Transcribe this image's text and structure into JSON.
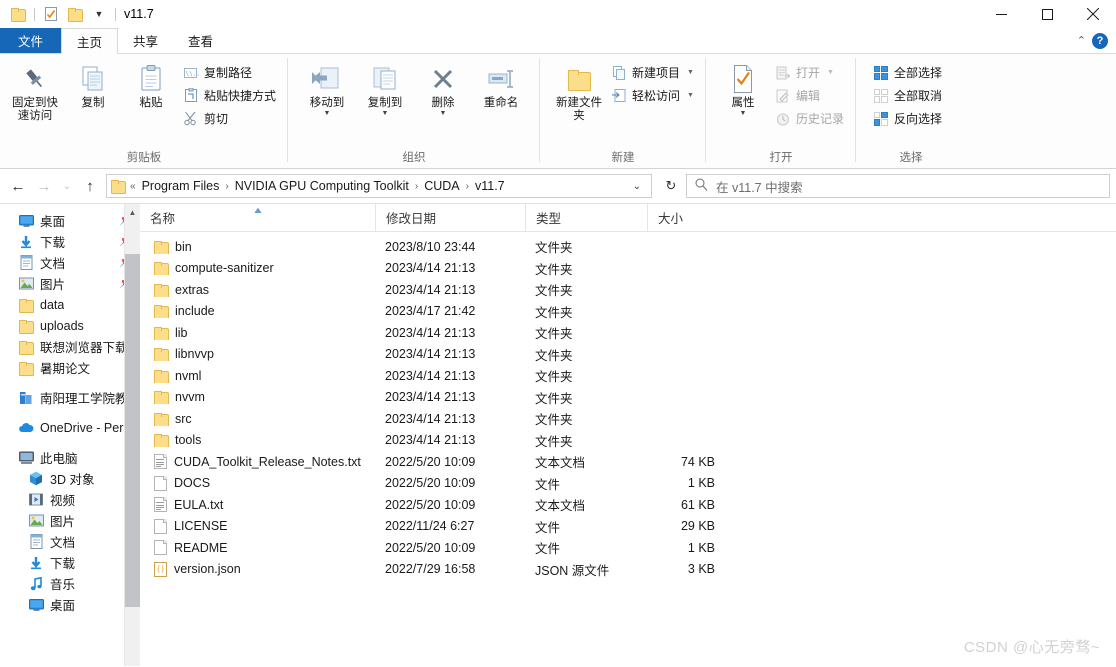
{
  "window": {
    "title": "v11.7",
    "quick_access": [
      "folder-icon",
      "properties-icon",
      "folder-icon",
      "dropdown-arrow-icon"
    ],
    "minimize_label": "–",
    "maximize_label": "☐",
    "close_label": "✕",
    "help_label": "?",
    "collapse_ribbon_label": "⌃"
  },
  "tabs": [
    {
      "label": "文件",
      "kind": "file"
    },
    {
      "label": "主页",
      "kind": "active"
    },
    {
      "label": "共享",
      "kind": "normal"
    },
    {
      "label": "查看",
      "kind": "normal"
    }
  ],
  "ribbon": {
    "groups": [
      {
        "label": "剪贴板",
        "big_buttons": [
          {
            "label": "固定到快速访问",
            "icon": "pin-icon"
          },
          {
            "label": "复制",
            "icon": "copy-icon"
          },
          {
            "label": "粘贴",
            "icon": "paste-icon"
          }
        ],
        "small_buttons": [
          {
            "label": "复制路径",
            "icon": "copy-path-icon",
            "disabled": false
          },
          {
            "label": "粘贴快捷方式",
            "icon": "paste-shortcut-icon",
            "disabled": false
          },
          {
            "label": "剪切",
            "icon": "scissors-icon",
            "disabled": false
          }
        ]
      },
      {
        "label": "组织",
        "big_buttons": [
          {
            "label": "移动到",
            "icon": "move-to-icon",
            "caret": true
          },
          {
            "label": "复制到",
            "icon": "copy-to-icon",
            "caret": true
          },
          {
            "label": "删除",
            "icon": "delete-icon",
            "caret": true
          },
          {
            "label": "重命名",
            "icon": "rename-icon"
          }
        ],
        "small_buttons": []
      },
      {
        "label": "新建",
        "big_buttons": [
          {
            "label": "新建文件夹",
            "icon": "new-folder-icon"
          }
        ],
        "small_buttons": [
          {
            "label": "新建项目",
            "icon": "new-item-icon",
            "caret": true,
            "disabled": false
          },
          {
            "label": "轻松访问",
            "icon": "easy-access-icon",
            "caret": true,
            "disabled": false
          }
        ]
      },
      {
        "label": "打开",
        "big_buttons": [
          {
            "label": "属性",
            "icon": "properties-icon",
            "caret": true
          }
        ],
        "small_buttons": [
          {
            "label": "打开",
            "icon": "open-icon",
            "caret": true,
            "disabled": true
          },
          {
            "label": "编辑",
            "icon": "edit-icon",
            "disabled": true
          },
          {
            "label": "历史记录",
            "icon": "history-icon",
            "disabled": true
          }
        ]
      },
      {
        "label": "选择",
        "big_buttons": [],
        "small_buttons": [
          {
            "label": "全部选择",
            "icon": "select-all-icon",
            "disabled": false
          },
          {
            "label": "全部取消",
            "icon": "select-none-icon",
            "disabled": false
          },
          {
            "label": "反向选择",
            "icon": "invert-selection-icon",
            "disabled": false
          }
        ]
      }
    ]
  },
  "address_bar": {
    "back_label": "←",
    "forward_label": "→",
    "recent_label": "⌄",
    "up_label": "↑",
    "overflow_label": "«",
    "crumbs": [
      "Program Files",
      "NVIDIA GPU Computing Toolkit",
      "CUDA",
      "v11.7"
    ],
    "separator": "›",
    "dropdown_label": "⌄",
    "refresh_label": "↻"
  },
  "search": {
    "placeholder": "在 v11.7 中搜索",
    "icon": "search-icon"
  },
  "sidebar": {
    "items": [
      {
        "label": "桌面",
        "icon": "desktop-icon",
        "pinned": true,
        "indent": false
      },
      {
        "label": "下载",
        "icon": "downloads-icon",
        "pinned": true,
        "indent": false
      },
      {
        "label": "文档",
        "icon": "documents-icon",
        "pinned": true,
        "indent": false
      },
      {
        "label": "图片",
        "icon": "pictures-icon",
        "pinned": true,
        "indent": false
      },
      {
        "label": "data",
        "icon": "folder-icon",
        "pinned": false,
        "indent": false
      },
      {
        "label": "uploads",
        "icon": "folder-icon",
        "pinned": false,
        "indent": false
      },
      {
        "label": "联想浏览器下载",
        "icon": "folder-icon",
        "pinned": false,
        "indent": false
      },
      {
        "label": "暑期论文",
        "icon": "folder-icon",
        "pinned": false,
        "indent": false
      },
      {
        "label": "南阳理工学院教职",
        "icon": "onedrive-business-icon",
        "pinned": false,
        "indent": false,
        "gap": true
      },
      {
        "label": "OneDrive - Pers",
        "icon": "onedrive-icon",
        "pinned": false,
        "indent": false,
        "gap": true
      },
      {
        "label": "此电脑",
        "icon": "this-pc-icon",
        "pinned": false,
        "indent": false,
        "gap": true
      },
      {
        "label": "3D 对象",
        "icon": "3d-objects-icon",
        "pinned": false,
        "indent": true
      },
      {
        "label": "视频",
        "icon": "videos-icon",
        "pinned": false,
        "indent": true
      },
      {
        "label": "图片",
        "icon": "pictures-icon",
        "pinned": false,
        "indent": true
      },
      {
        "label": "文档",
        "icon": "documents-icon",
        "pinned": false,
        "indent": true
      },
      {
        "label": "下载",
        "icon": "downloads-icon",
        "pinned": false,
        "indent": true
      },
      {
        "label": "音乐",
        "icon": "music-icon",
        "pinned": false,
        "indent": true
      },
      {
        "label": "桌面",
        "icon": "desktop-icon",
        "pinned": false,
        "indent": true
      }
    ]
  },
  "filelist": {
    "columns": [
      {
        "label": "名称",
        "sorted": true
      },
      {
        "label": "修改日期",
        "sorted": false
      },
      {
        "label": "类型",
        "sorted": false
      },
      {
        "label": "大小",
        "sorted": false
      }
    ],
    "rows": [
      {
        "name": "bin",
        "date": "2023/8/10 23:44",
        "type": "文件夹",
        "size": "",
        "icon": "folder-icon"
      },
      {
        "name": "compute-sanitizer",
        "date": "2023/4/14 21:13",
        "type": "文件夹",
        "size": "",
        "icon": "folder-icon"
      },
      {
        "name": "extras",
        "date": "2023/4/14 21:13",
        "type": "文件夹",
        "size": "",
        "icon": "folder-icon"
      },
      {
        "name": "include",
        "date": "2023/4/17 21:42",
        "type": "文件夹",
        "size": "",
        "icon": "folder-icon"
      },
      {
        "name": "lib",
        "date": "2023/4/14 21:13",
        "type": "文件夹",
        "size": "",
        "icon": "folder-icon"
      },
      {
        "name": "libnvvp",
        "date": "2023/4/14 21:13",
        "type": "文件夹",
        "size": "",
        "icon": "folder-icon"
      },
      {
        "name": "nvml",
        "date": "2023/4/14 21:13",
        "type": "文件夹",
        "size": "",
        "icon": "folder-icon"
      },
      {
        "name": "nvvm",
        "date": "2023/4/14 21:13",
        "type": "文件夹",
        "size": "",
        "icon": "folder-icon"
      },
      {
        "name": "src",
        "date": "2023/4/14 21:13",
        "type": "文件夹",
        "size": "",
        "icon": "folder-icon"
      },
      {
        "name": "tools",
        "date": "2023/4/14 21:13",
        "type": "文件夹",
        "size": "",
        "icon": "folder-icon"
      },
      {
        "name": "CUDA_Toolkit_Release_Notes.txt",
        "date": "2022/5/20 10:09",
        "type": "文本文档",
        "size": "74 KB",
        "icon": "text-file-icon"
      },
      {
        "name": "DOCS",
        "date": "2022/5/20 10:09",
        "type": "文件",
        "size": "1 KB",
        "icon": "generic-file-icon"
      },
      {
        "name": "EULA.txt",
        "date": "2022/5/20 10:09",
        "type": "文本文档",
        "size": "61 KB",
        "icon": "text-file-icon"
      },
      {
        "name": "LICENSE",
        "date": "2022/11/24 6:27",
        "type": "文件",
        "size": "29 KB",
        "icon": "generic-file-icon"
      },
      {
        "name": "README",
        "date": "2022/5/20 10:09",
        "type": "文件",
        "size": "1 KB",
        "icon": "generic-file-icon"
      },
      {
        "name": "version.json",
        "date": "2022/7/29 16:58",
        "type": "JSON 源文件",
        "size": "3 KB",
        "icon": "json-file-icon"
      }
    ]
  },
  "watermark": {
    "text": "CSDN @心无旁骛~"
  },
  "colors": {
    "accent": "#1667b8",
    "folder": "#fbdd8a",
    "hover": "#e8f1fb",
    "watermark": "#d2d2d2"
  }
}
